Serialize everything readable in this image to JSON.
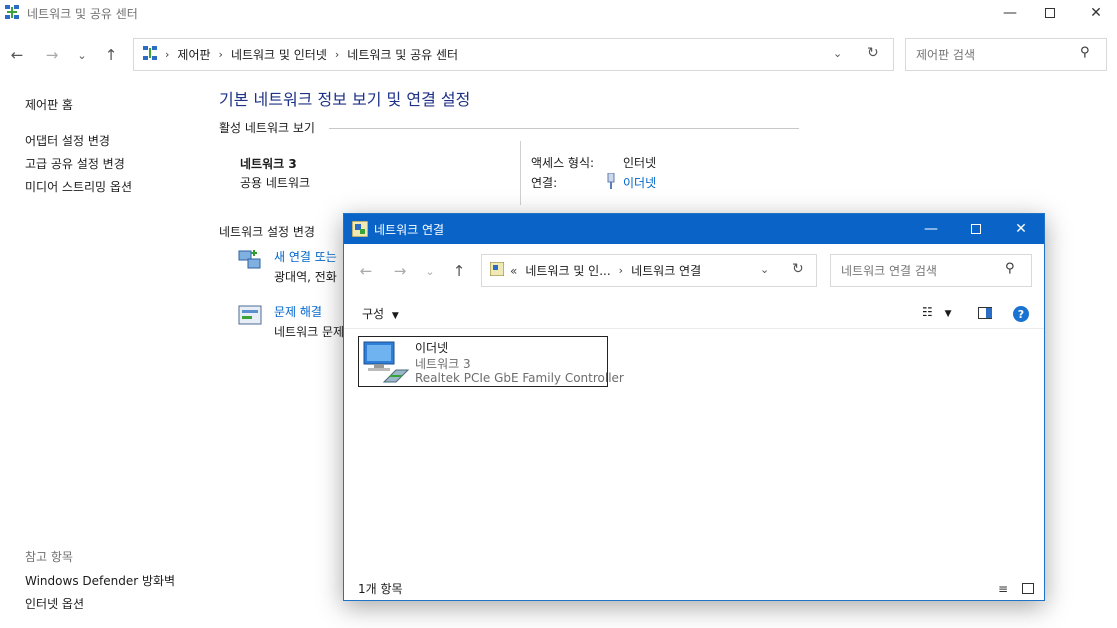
{
  "window": {
    "title": "네트워크 및 공유 센터",
    "minimize_icon": "minimize-icon",
    "maximize_icon": "maximize-icon",
    "close_icon": "close-icon"
  },
  "nav": {
    "breadcrumb": [
      "제어판",
      "네트워크 및 인터넷",
      "네트워크 및 공유 센터"
    ],
    "search_placeholder": "제어판 검색"
  },
  "sidebar": {
    "home": "제어판 홈",
    "links": [
      "어댑터 설정 변경",
      "고급 공유 설정 변경",
      "미디어 스트리밍 옵션"
    ],
    "see_also_caption": "참고 항목",
    "see_also": [
      "Windows Defender 방화벽",
      "인터넷 옵션"
    ]
  },
  "main": {
    "heading": "기본 네트워크 정보 보기 및 연결 설정",
    "active_section": "활성 네트워크 보기",
    "network_name": "네트워크 3",
    "network_type": "공용 네트워크",
    "access_type_label": "액세스 형식:",
    "access_type_value": "인터넷",
    "connections_label": "연결:",
    "connections_value": "이더넷",
    "change_section": "네트워크 설정 변경",
    "new_connection_link": "새 연결 또는",
    "new_connection_desc": "광대역, 전화",
    "troubleshoot_link": "문제 해결",
    "troubleshoot_desc": "네트워크 문제"
  },
  "dialog": {
    "title": "네트워크 연결",
    "breadcrumb_prefix": "«",
    "breadcrumb": [
      "네트워크 및 인...",
      "네트워크 연결"
    ],
    "search_placeholder": "네트워크 연결 검색",
    "organize_label": "구성",
    "item": {
      "name": "이더넷",
      "network": "네트워크 3",
      "adapter": "Realtek PCIe GbE Family Controller"
    },
    "status": "1개 항목"
  }
}
